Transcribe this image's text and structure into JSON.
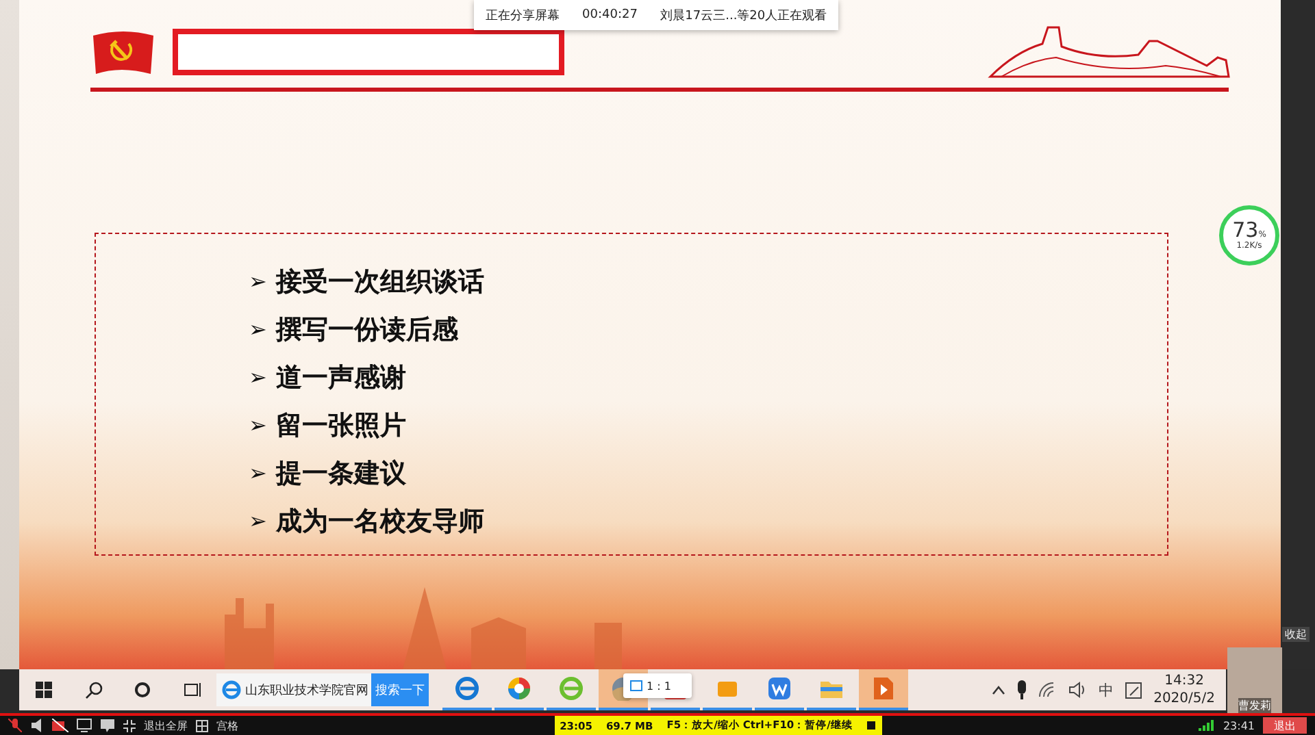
{
  "share_bar": {
    "status": "正在分享屏幕",
    "timer": "00:40:27",
    "viewers": "刘晨17云三...等20人正在观看"
  },
  "slide": {
    "items": [
      {
        "marker": "➢",
        "text": "接受一次组织谈话"
      },
      {
        "marker": "➢",
        "text": "撰写一份读后感"
      },
      {
        "marker": "➢",
        "text": "道一声感谢"
      },
      {
        "marker": "➢",
        "text": "留一张照片"
      },
      {
        "marker": "➢",
        "text": "提一条建议"
      },
      {
        "marker": "➢",
        "text": "成为一名校友导师"
      }
    ]
  },
  "net_widget": {
    "percent": "73",
    "unit": "%",
    "speed": "1.2K/s"
  },
  "collapse_label": "收起",
  "taskbar": {
    "search_text": "山东职业技术学院官网",
    "search_button": "搜索一下",
    "zoom_popup": "1 : 1",
    "time": "14:32",
    "date": "2020/5/2",
    "ime": "中"
  },
  "video": {
    "name": "曹发莉"
  },
  "bottom_bar": {
    "exit_fullscreen": "退出全屏",
    "grid": "宫格",
    "rec_time": "23:05",
    "size": "69.7 MB",
    "hint": "F5：放大/缩小 Ctrl+F10：暂停/继续",
    "clock": "23:41",
    "exit": "退出"
  }
}
